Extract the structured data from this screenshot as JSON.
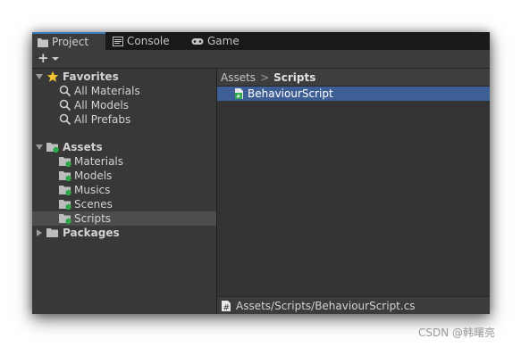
{
  "tabs": [
    {
      "label": "Project",
      "icon": "folder-icon"
    },
    {
      "label": "Console",
      "icon": "console-icon"
    },
    {
      "label": "Game",
      "icon": "gamepad-icon"
    }
  ],
  "toolbar": {
    "add_symbol": "+"
  },
  "tree": {
    "favorites": {
      "label": "Favorites",
      "items": [
        "All Materials",
        "All Models",
        "All Prefabs"
      ]
    },
    "assets": {
      "label": "Assets",
      "items": [
        "Materials",
        "Models",
        "Musics",
        "Scenes",
        "Scripts"
      ]
    },
    "packages": {
      "label": "Packages"
    }
  },
  "breadcrumb": {
    "root": "Assets",
    "separator": ">",
    "current": "Scripts"
  },
  "files": [
    {
      "name": "BehaviourScript",
      "icon": "csharp-script-icon"
    }
  ],
  "status": {
    "path": "Assets/Scripts/BehaviourScript.cs"
  },
  "watermark": "CSDN @韩曙亮",
  "colors": {
    "selection": "#3e5f96",
    "tab_accent": "#3a79bb",
    "star": "#f4c430",
    "folder_badge": "#2fa84f"
  }
}
